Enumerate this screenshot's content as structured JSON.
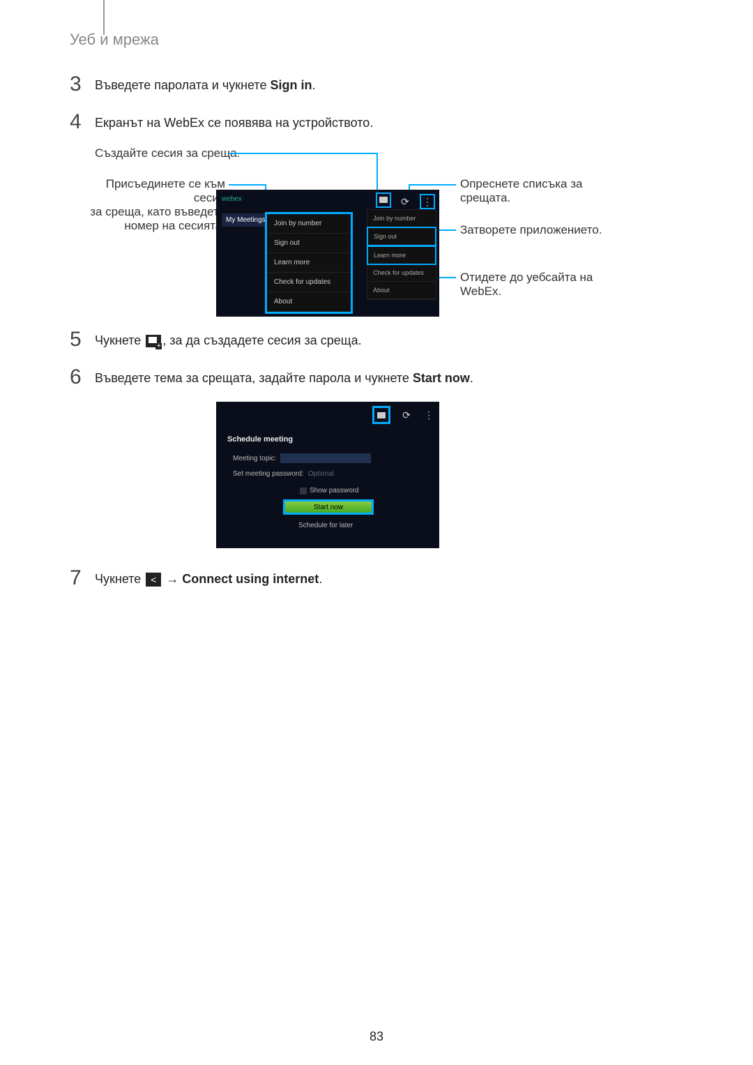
{
  "header": {
    "title": "Уеб и мрежа"
  },
  "steps": {
    "s3": {
      "num": "3",
      "text_a": "Въведете паролата и чукнете ",
      "bold": "Sign in",
      "tail": "."
    },
    "s4": {
      "num": "4",
      "text": "Екранът на WebEx се появява на устройството."
    },
    "s5": {
      "num": "5",
      "text_a": "Чукнете ",
      "text_b": ", за да създадете сесия за среща."
    },
    "s6": {
      "num": "6",
      "text_a": "Въведете тема за срещата, задайте парола и чукнете ",
      "bold": "Start now",
      "tail": "."
    },
    "s7": {
      "num": "7",
      "text_a": "Чукнете ",
      "arrow": " → ",
      "bold": "Connect using internet",
      "tail": "."
    }
  },
  "callouts": {
    "create": "Създайте сесия за среща.",
    "join_l1": "Присъединете се към сесия",
    "join_l2": "за среща, като въведете",
    "join_l3": "номер на сесията.",
    "refresh_l1": "Опреснете списъка за",
    "refresh_l2": "срещата.",
    "close": "Затворете приложението.",
    "website_l1": "Отидете до уебсайта на",
    "website_l2": "WebEx."
  },
  "diagram1": {
    "logo": "webex",
    "tab": "My Meetings",
    "menu": {
      "join": "Join by number",
      "signout": "Sign out",
      "learn": "Learn more",
      "check": "Check for updates",
      "about": "About"
    }
  },
  "diagram2": {
    "title": "Schedule meeting",
    "topic_label": "Meeting topic:",
    "pwd_label": "Set meeting password:",
    "pwd_placeholder": "Optional",
    "show_pwd": "Show password",
    "start": "Start now",
    "later": "Schedule for later"
  },
  "page_number": "83"
}
